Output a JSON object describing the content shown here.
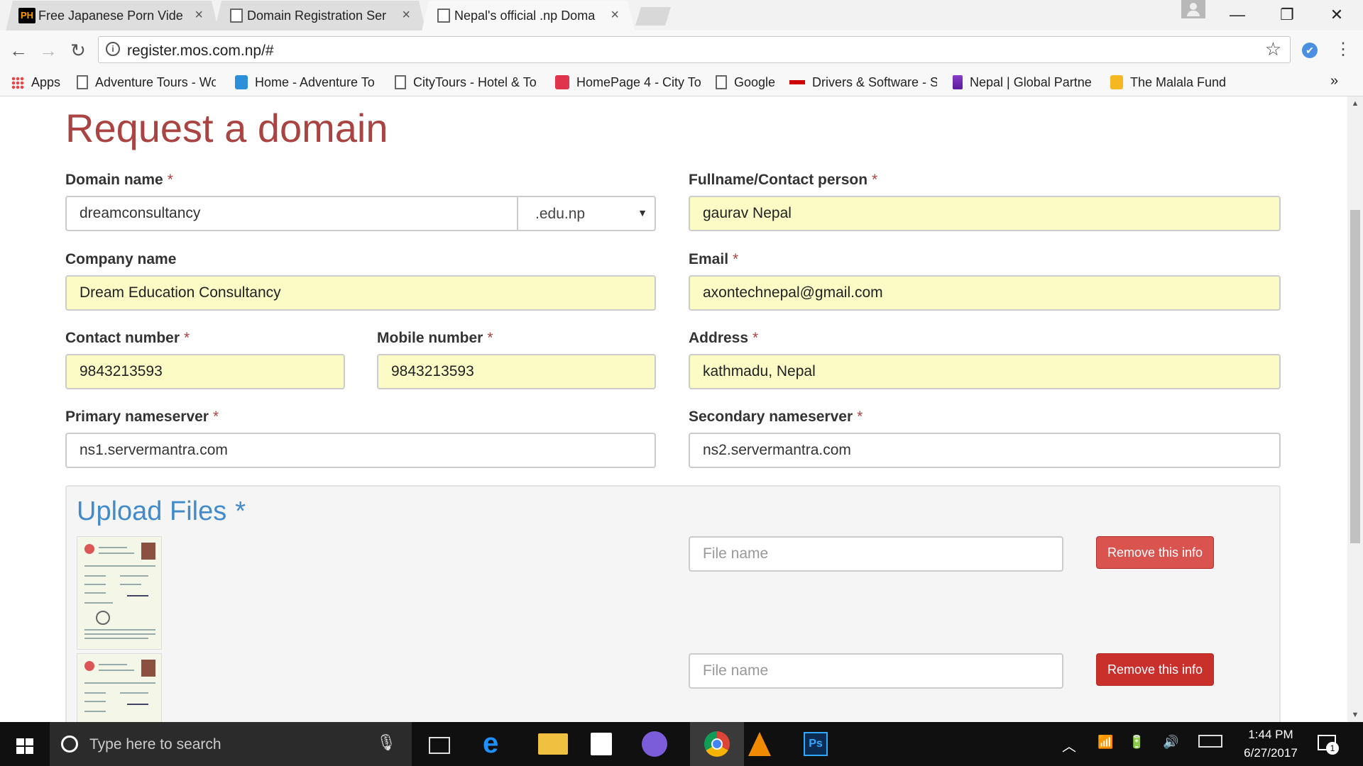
{
  "browser": {
    "tabs": [
      {
        "title": "Free Japanese Porn Vide",
        "favicon": "ph-favicon",
        "favicon_text": "PH"
      },
      {
        "title": "Domain Registration Ser",
        "favicon": "page-icon"
      },
      {
        "title": "Nepal's official .np Doma",
        "favicon": "page-icon"
      }
    ],
    "window_controls": {
      "minimize": "—",
      "restore": "❐",
      "close": "✕"
    },
    "url": "register.mos.com.np/#",
    "bookmarks": [
      {
        "label": "Apps",
        "icon": "apps-grid-icon"
      },
      {
        "label": "Adventure Tours - Wo",
        "icon": "page-icon"
      },
      {
        "label": "Home - Adventure To",
        "icon": "adventure-tours-icon"
      },
      {
        "label": "CityTours - Hotel & To",
        "icon": "page-icon"
      },
      {
        "label": "HomePage 4 - City To",
        "icon": "citytours-icon"
      },
      {
        "label": "Google",
        "icon": "page-icon"
      },
      {
        "label": "Drivers & Software - S",
        "icon": "canon-icon"
      },
      {
        "label": "Nepal | Global Partne",
        "icon": "global-partner-icon"
      },
      {
        "label": "The Malala Fund",
        "icon": "malala-icon"
      }
    ],
    "bookmarks_overflow": "»"
  },
  "form": {
    "title": "Request a domain",
    "required_mark": "*",
    "domain_name": {
      "label": "Domain name",
      "value": "dreamconsultancy",
      "tld": ".edu.np"
    },
    "fullname": {
      "label": "Fullname/Contact person",
      "value": "gaurav Nepal"
    },
    "company": {
      "label": "Company name",
      "value": "Dream Education Consultancy"
    },
    "email": {
      "label": "Email",
      "value": "axontechnepal@gmail.com"
    },
    "contact_number": {
      "label": "Contact number",
      "value": "9843213593"
    },
    "mobile_number": {
      "label": "Mobile number",
      "value": "9843213593"
    },
    "address": {
      "label": "Address",
      "value": "kathmadu, Nepal"
    },
    "primary_ns": {
      "label": "Primary nameserver",
      "value": "ns1.servermantra.com"
    },
    "secondary_ns": {
      "label": "Secondary nameserver",
      "value": "ns2.servermantra.com"
    }
  },
  "upload": {
    "title": "Upload Files",
    "files": [
      {
        "placeholder": "File name",
        "remove_label": "Remove this info"
      },
      {
        "placeholder": "File name",
        "remove_label": "Remove this info"
      }
    ]
  },
  "taskbar": {
    "search_placeholder": "Type here to search",
    "time": "1:44 PM",
    "date": "6/27/2017",
    "notification_count": "1"
  },
  "colors": {
    "title_red": "#a94442",
    "autofill_yellow": "#fbfbc6",
    "upload_blue": "#428bca",
    "remove_button": "#d9534f"
  }
}
